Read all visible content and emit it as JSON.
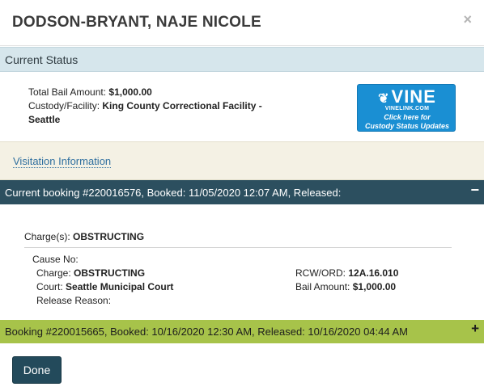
{
  "header": {
    "title": "DODSON-BRYANT, NAJE NICOLE",
    "close_glyph": "×"
  },
  "current_status": {
    "heading": "Current Status",
    "bail_label": "Total Bail Amount:",
    "bail_value": "$1,000.00",
    "facility_label": "Custody/Facility:",
    "facility_value": "King County Correctional Facility - Seattle"
  },
  "vine": {
    "logo_text": "VINE",
    "site": "VINELINK.COM",
    "cta_line1": "Click here for",
    "cta_line2": "Custody Status Updates",
    "color": "#1a8fd3"
  },
  "visitation": {
    "link_text": "Visitation Information"
  },
  "bookings": [
    {
      "header": "Current booking #220016576, Booked: 11/05/2020 12:07 AM, Released:",
      "toggle": "−",
      "expanded": true,
      "color": "#2c4f5f",
      "charges_label": "Charge(s):",
      "charges_value": "OBSTRUCTING",
      "cause_label": "Cause No:",
      "cause_value": "",
      "charge_label": "Charge:",
      "charge_value": "OBSTRUCTING",
      "court_label": "Court:",
      "court_value": "Seattle Municipal Court",
      "release_label": "Release Reason:",
      "release_value": "",
      "rcw_label": "RCW/ORD:",
      "rcw_value": "12A.16.010",
      "bail_label": "Bail Amount:",
      "bail_value": "$1,000.00"
    },
    {
      "header": "Booking #220015665, Booked: 10/16/2020 12:30 AM, Released: 10/16/2020 04:44 AM",
      "toggle": "+",
      "expanded": false,
      "color": "#a7c34a"
    }
  ],
  "footer": {
    "done_label": "Done"
  }
}
